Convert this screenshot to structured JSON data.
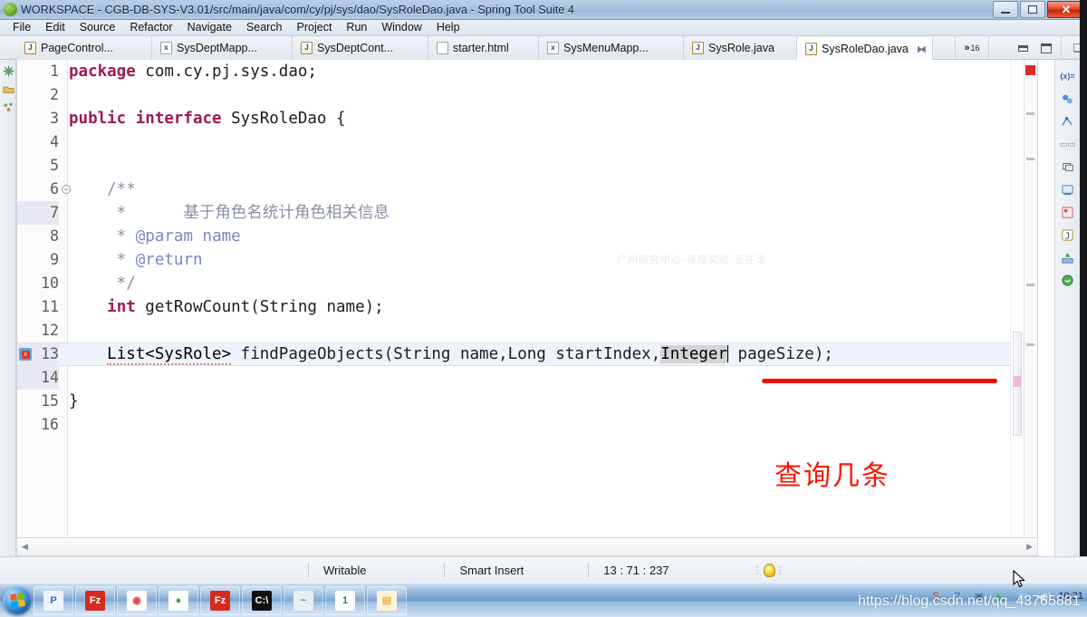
{
  "window": {
    "title": "WORKSPACE - CGB-DB-SYS-V3.01/src/main/java/com/cy/pj/sys/dao/SysRoleDao.java - Spring Tool Suite 4",
    "app_icon": "sts-green-circle-icon",
    "controls": {
      "minimize": "–",
      "restore": "❐",
      "close": "✕"
    }
  },
  "menubar": {
    "items": [
      "File",
      "Edit",
      "Source",
      "Refactor",
      "Navigate",
      "Search",
      "Project",
      "Run",
      "Window",
      "Help"
    ]
  },
  "tabs": {
    "items": [
      {
        "label": "PageControl...",
        "type": "java",
        "badge": "J",
        "active": false,
        "closable": false
      },
      {
        "label": "SysDeptMapp...",
        "type": "xml",
        "badge": "x",
        "active": false,
        "closable": false
      },
      {
        "label": "SysDeptCont...",
        "type": "java",
        "badge": "J",
        "active": false,
        "closable": false
      },
      {
        "label": "starter.html",
        "type": "html",
        "badge": "",
        "active": false,
        "closable": false
      },
      {
        "label": "SysMenuMapp...",
        "type": "xml",
        "badge": "x",
        "active": false,
        "closable": false
      },
      {
        "label": "SysRole.java",
        "type": "java",
        "badge": "J",
        "active": false,
        "closable": false
      },
      {
        "label": "SysRoleDao.java",
        "type": "java",
        "badge": "J",
        "active": true,
        "closable": true,
        "close_glyph": "⧓"
      }
    ],
    "overflow": {
      "chevron": "»",
      "count": "16"
    },
    "minimize_label": "Minimize",
    "maximize_label": "Maximize",
    "pin_label": "Restore"
  },
  "left_strip": {
    "icons": [
      "bug-icon",
      "package-explorer-icon",
      "outline-icon"
    ]
  },
  "right_strip": {
    "icons": [
      "variables-icon",
      "breakpoints-icon",
      "servers-icon",
      "console-icon",
      "terminal-icon",
      "problems-icon",
      "progress-icon",
      "java-perspective-icon",
      "boot-dashboard-icon",
      "spring-icon"
    ]
  },
  "editor": {
    "file_name": "SysRoleDao.java",
    "current_line": 13,
    "lines": [
      {
        "n": "1",
        "fold": false,
        "marker": "",
        "current": false,
        "tokens": [
          {
            "t": "package",
            "c": "kw"
          },
          {
            "t": " com.cy.pj.sys.dao;",
            "c": "plain"
          }
        ]
      },
      {
        "n": "2",
        "fold": false,
        "marker": "",
        "current": false,
        "tokens": []
      },
      {
        "n": "3",
        "fold": false,
        "marker": "",
        "current": false,
        "tokens": [
          {
            "t": "public interface",
            "c": "kw"
          },
          {
            "t": " SysRoleDao {",
            "c": "plain"
          }
        ]
      },
      {
        "n": "4",
        "fold": false,
        "marker": "",
        "current": false,
        "tokens": []
      },
      {
        "n": "5",
        "fold": false,
        "marker": "",
        "current": false,
        "tokens": []
      },
      {
        "n": "6",
        "fold": true,
        "marker": "",
        "current": false,
        "tokens": [
          {
            "t": "    /**",
            "c": "doc"
          }
        ]
      },
      {
        "n": "7",
        "fold": false,
        "marker": "",
        "current": false,
        "hl_num": true,
        "tokens": [
          {
            "t": "     *      基于角色名统计角色相关信息",
            "c": "doc"
          }
        ]
      },
      {
        "n": "8",
        "fold": false,
        "marker": "",
        "current": false,
        "tokens": [
          {
            "t": "     * ",
            "c": "doc"
          },
          {
            "t": "@param",
            "c": "tagk"
          },
          {
            "t": " ",
            "c": "doc"
          },
          {
            "t": "name",
            "c": "tagk"
          }
        ]
      },
      {
        "n": "9",
        "fold": false,
        "marker": "",
        "current": false,
        "tokens": [
          {
            "t": "     * ",
            "c": "doc"
          },
          {
            "t": "@return",
            "c": "tagk"
          }
        ]
      },
      {
        "n": "10",
        "fold": false,
        "marker": "",
        "current": false,
        "tokens": [
          {
            "t": "     */",
            "c": "doc"
          }
        ]
      },
      {
        "n": "11",
        "fold": false,
        "marker": "",
        "current": false,
        "tokens": [
          {
            "t": "    ",
            "c": "plain"
          },
          {
            "t": "int",
            "c": "kw"
          },
          {
            "t": " getRowCount(String name);",
            "c": "plain"
          }
        ]
      },
      {
        "n": "12",
        "fold": false,
        "marker": "",
        "current": false,
        "tokens": []
      },
      {
        "n": "13",
        "fold": false,
        "marker": "error-icon",
        "current": true,
        "tokens": [
          {
            "t": "    ",
            "c": "plain"
          },
          {
            "t": "List<SysRole>",
            "c": "squig"
          },
          {
            "t": " findPageObjects(String name,Long startIndex,",
            "c": "plain"
          },
          {
            "t": "Integer",
            "c": "sel"
          },
          {
            "t": "§caret§",
            "c": "caret"
          },
          {
            "t": " pageSize);",
            "c": "plain"
          }
        ]
      },
      {
        "n": "14",
        "fold": false,
        "marker": "",
        "current": false,
        "hl_num": true,
        "tokens": []
      },
      {
        "n": "15",
        "fold": false,
        "marker": "",
        "current": false,
        "tokens": [
          {
            "t": "}",
            "c": "plain"
          }
        ]
      },
      {
        "n": "16",
        "fold": false,
        "marker": "",
        "current": false,
        "tokens": []
      }
    ],
    "watermark": "广州研究中心-课程实验-正在录",
    "scrollbar": {
      "horizontal_left_arrow": "◀",
      "horizontal_right_arrow": "▶"
    }
  },
  "annotations": {
    "red_note": "查询几条",
    "red_underline": "red-underline-under-Integer-pageSize",
    "red_color": "#fc1403"
  },
  "statusbar": {
    "writable": "Writable",
    "insert_mode": "Smart Insert",
    "position": "13 : 71 : 237",
    "quickfix_icon": "lightbulb-icon"
  },
  "taskbar": {
    "start": "windows-start-orb",
    "buttons": [
      {
        "name": "pycharm-icon",
        "glyph": "P",
        "fg": "#2b6ad0",
        "bg": "#eef3fb"
      },
      {
        "name": "filezilla-icon",
        "glyph": "Fz",
        "fg": "#ffffff",
        "bg": "#d52b1e"
      },
      {
        "name": "chrome-icon",
        "glyph": "◉",
        "fg": "#e8453c",
        "bg": "#ffffff"
      },
      {
        "name": "browser-green-icon",
        "glyph": "●",
        "fg": "#34a853",
        "bg": "#ffffff"
      },
      {
        "name": "filezilla-2-icon",
        "glyph": "Fz",
        "fg": "#ffffff",
        "bg": "#d52b1e"
      },
      {
        "name": "cmd-console-icon",
        "glyph": "C:\\",
        "fg": "#ffffff",
        "bg": "#111111"
      },
      {
        "name": "editor-icon",
        "glyph": "~",
        "fg": "#5a7fa8",
        "bg": "#e9eef5"
      },
      {
        "name": "onenote-icon",
        "glyph": "1",
        "fg": "#18796b",
        "bg": "#ffffff"
      },
      {
        "name": "explorer-icon",
        "glyph": "▤",
        "fg": "#e8b84b",
        "bg": "#fdf3d8"
      }
    ],
    "tray": [
      {
        "name": "sogou-input-icon",
        "glyph": "S",
        "color": "#ee4411"
      },
      {
        "name": "help-icon",
        "glyph": "?",
        "color": "#2a72c8"
      },
      {
        "name": "network-monitor-icon",
        "glyph": "▣",
        "color": "#4a6a8c"
      },
      {
        "name": "qq-icon",
        "glyph": "◣",
        "color": "#2faf4a"
      },
      {
        "name": "network-icon",
        "glyph": "▤",
        "color": "#bcd2e8"
      },
      {
        "name": "volume-icon",
        "glyph": "◀))",
        "color": "#dbe7f3"
      }
    ],
    "clock": "10:21"
  },
  "watermark_url": "https://blog.csdn.net/qq_43765881"
}
